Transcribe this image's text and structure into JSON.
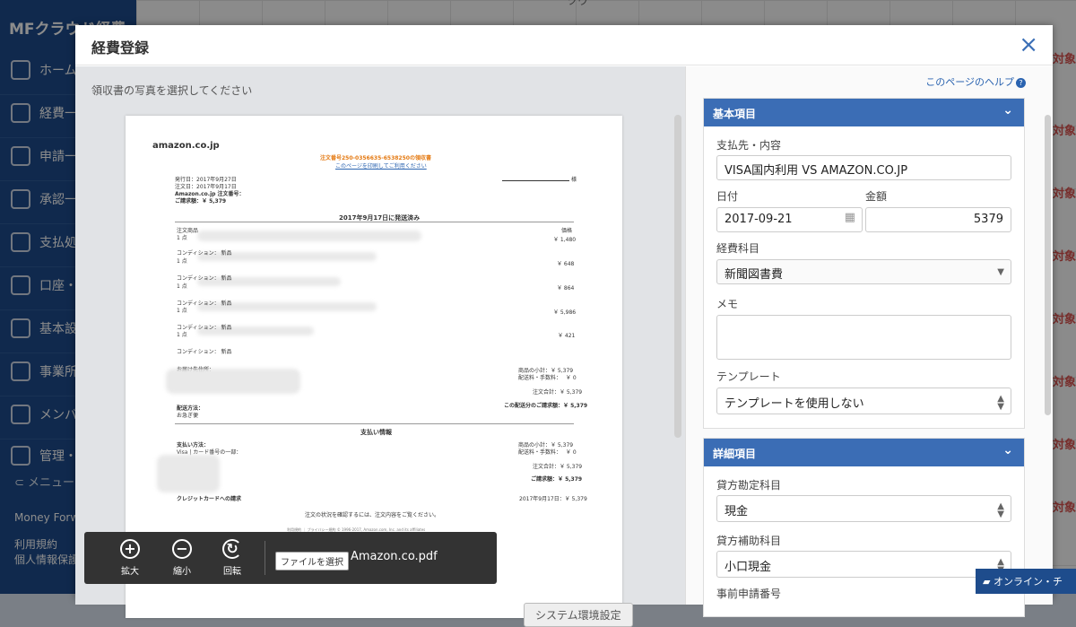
{
  "app": {
    "logo_text": "MFクラウド経費",
    "nav": [
      "ホーム",
      "経費一",
      "申請一",
      "承認一",
      "支払処",
      "口座・",
      "基本設",
      "事業所",
      "メンバ",
      "管理・"
    ],
    "collapse_label": "メニュー",
    "footer": [
      "Money Forwa",
      "利用規約",
      "個人情報保護"
    ],
    "tag_text": "対象",
    "header_fragment": "ツウ"
  },
  "modal": {
    "title": "経費登録",
    "close_glyph": "×",
    "left": {
      "caption": "領収書の写真を選択してください",
      "doc": {
        "logo": "amazon.co.jp",
        "order_title": "注文番号250-0356635-6538250の領収書",
        "print_note": "このページを印刷してご利用ください",
        "name_suffix": "様",
        "issue_date": "発行日：2017年9月27日",
        "order_date": "注文日：2017年9月17日",
        "order_no_label": "Amazon.co.jp 注文番号：",
        "total_label": "ご請求額：￥ 5,379",
        "shipped": "2017年9月17日に発送済み",
        "col_item": "注文商品",
        "col_price": "価格",
        "prices": [
          "￥ 1,480",
          "￥ 648",
          "￥ 864",
          "￥ 5,986",
          "￥ 421"
        ],
        "qty": "1 点",
        "condition": "コンディション： 新品",
        "ship_to": "お届け先住所：",
        "ship_method": "配送方法：",
        "ship_method_val": "お急ぎ便",
        "subtotal": "商品の小計：￥ 5,379",
        "shipping_fee": "配送料・手数料：　 ￥ 0",
        "order_total": "注文合計：￥ 5,379",
        "billed": "この配送分のご請求額：￥ 5,379",
        "payment_title": "支払い情報",
        "payment_method": "支払い方法：",
        "card": "Visa | カード番号の一部：",
        "pay_subtotal": "商品の小計：￥ 5,379",
        "pay_shipping": "配送料・手数料：　 ￥ 0",
        "pay_total": "注文合計：￥ 5,379",
        "pay_billed": "ご請求額：￥ 5,379",
        "credit_label": "クレジットカードへの請求",
        "credit_date": "2017年9月17日：￥ 5,379",
        "footer_note": "注文の状況を確認するには、注文内容をご覧ください。",
        "footer_small": "利用規約 ｜ プライバシー規約 © 1996-2017, Amazon.com, Inc. and its affiliates"
      },
      "toolbar": {
        "zoom_in": "拡大",
        "zoom_out": "縮小",
        "rotate": "回転",
        "file_button": "ファイルを選択",
        "file_name": "Amazon.co.pdf"
      },
      "tooltip": "システム環境設定"
    },
    "right": {
      "help_link": "このページのヘルプ",
      "basic": {
        "title": "基本項目",
        "payee_label": "支払先・内容",
        "payee_value": "VISA国内利用 VS AMAZON.CO.JP",
        "date_label": "日付",
        "date_value": "2017-09-21",
        "amount_label": "金額",
        "amount_value": "5379",
        "category_label": "経費科目",
        "category_value": "新聞図書費",
        "memo_label": "メモ",
        "memo_value": "",
        "template_label": "テンプレート",
        "template_value": "テンプレートを使用しない"
      },
      "detail": {
        "title": "詳細項目",
        "credit_account_label": "貸方勘定科目",
        "credit_account_value": "現金",
        "sub_account_label": "貸方補助科目",
        "sub_account_value": "小口現金",
        "prior_app_label": "事前申請番号"
      }
    },
    "chat_label": "オンライン・チ"
  }
}
